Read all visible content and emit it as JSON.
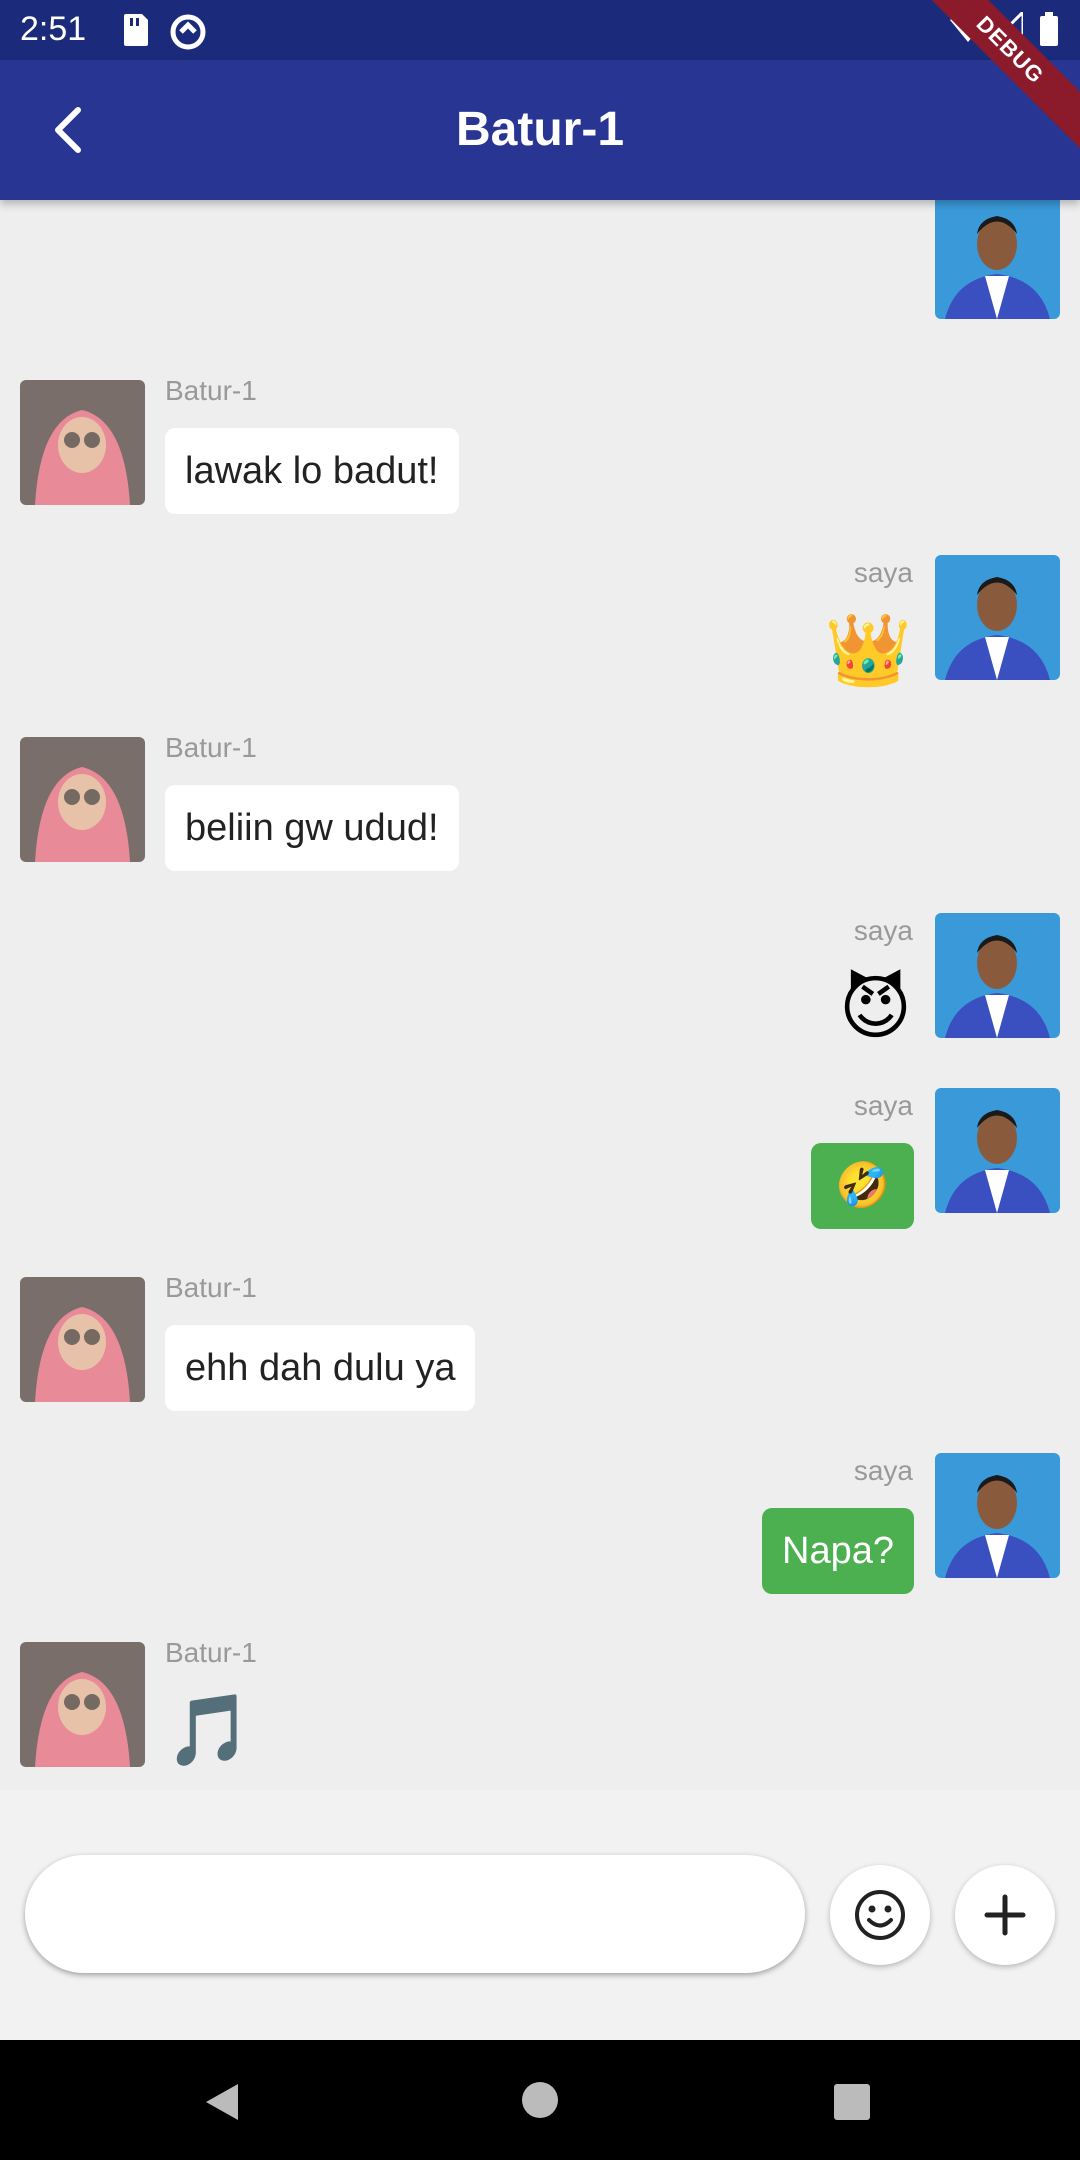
{
  "status_bar": {
    "time": "2:51"
  },
  "debug_banner": "DEBUG",
  "app_bar": {
    "title": "Batur-1"
  },
  "messages": [
    {
      "sender": "saya",
      "type": "emoji",
      "content": "👌"
    },
    {
      "sender": "Batur-1",
      "type": "text",
      "content": "lawak lo badut!"
    },
    {
      "sender": "saya",
      "type": "emoji",
      "content": "👑"
    },
    {
      "sender": "Batur-1",
      "type": "text",
      "content": "beliin gw udud!"
    },
    {
      "sender": "saya",
      "type": "emoji",
      "content": "😈"
    },
    {
      "sender": "saya",
      "type": "emoji-bubble",
      "content": "🤣"
    },
    {
      "sender": "Batur-1",
      "type": "text",
      "content": "ehh dah dulu ya"
    },
    {
      "sender": "saya",
      "type": "text-bubble",
      "content": "Napa?"
    },
    {
      "sender": "Batur-1",
      "type": "emoji",
      "content": "🎵"
    }
  ],
  "input": {
    "placeholder": "",
    "value": ""
  },
  "buttons": {
    "emoji_icon": "smiley-icon",
    "add_icon": "plus-icon"
  },
  "colors": {
    "app_bar": "#283593",
    "status_bar": "#1b2a7a",
    "my_bubble": "#4caf50",
    "their_bubble": "#ffffff"
  }
}
